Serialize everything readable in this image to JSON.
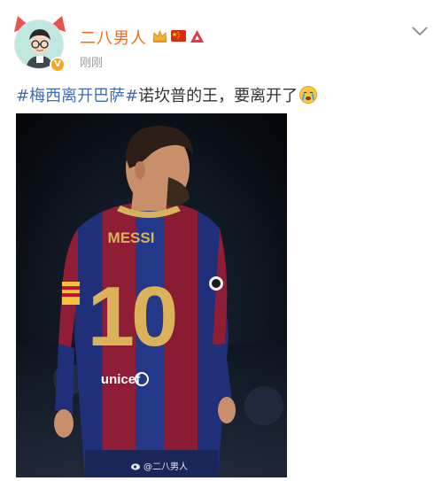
{
  "post": {
    "username": "二八男人",
    "verified_badge": "V",
    "timestamp": "刚刚",
    "hashtag": "#梅西离开巴萨#",
    "text": "诺坎普的王，要离开了",
    "emoji": "crying-face",
    "badges": [
      "crown-icon",
      "china-flag-icon",
      "red-triangle-icon"
    ]
  },
  "photo": {
    "jersey_name": "MESSI",
    "jersey_number": "10",
    "sponsor": "unicef",
    "watermark": "@二八男人"
  },
  "colors": {
    "username": "#f26b1d",
    "hashtag": "#3f6bb3",
    "timestamp": "#9b9b9b",
    "jersey_blue": "#1f2f7a",
    "jersey_red": "#8e1d35",
    "number_gold": "#d9b25a"
  }
}
